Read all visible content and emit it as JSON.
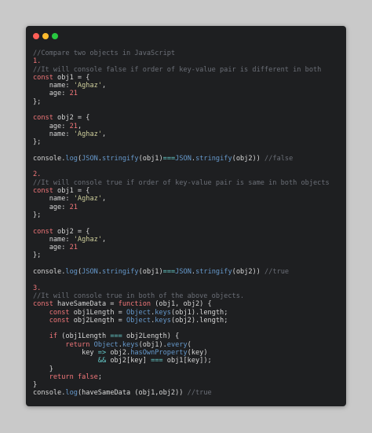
{
  "window": {
    "controls": [
      "close",
      "minimize",
      "zoom"
    ]
  },
  "code_lines": [
    [
      {
        "t": "cm",
        "v": "//Compare two objects in JavaScript"
      }
    ],
    [
      {
        "t": "lbl",
        "v": "1."
      }
    ],
    [
      {
        "t": "cm",
        "v": "//It will console false if order of key-value pair is different in both"
      }
    ],
    [
      {
        "t": "kw",
        "v": "const"
      },
      {
        "t": "var",
        "v": " obj1 = {"
      }
    ],
    [
      {
        "t": "txt",
        "v": "    name: "
      },
      {
        "t": "str",
        "v": "'Aghaz'"
      },
      {
        "t": "txt",
        "v": ","
      }
    ],
    [
      {
        "t": "txt",
        "v": "    age: "
      },
      {
        "t": "num",
        "v": "21"
      }
    ],
    [
      {
        "t": "txt",
        "v": "};"
      }
    ],
    [],
    [
      {
        "t": "kw",
        "v": "const"
      },
      {
        "t": "var",
        "v": " obj2 = {"
      }
    ],
    [
      {
        "t": "txt",
        "v": "    age: "
      },
      {
        "t": "num",
        "v": "21"
      },
      {
        "t": "txt",
        "v": ","
      }
    ],
    [
      {
        "t": "txt",
        "v": "    name: "
      },
      {
        "t": "str",
        "v": "'Aghaz'"
      },
      {
        "t": "txt",
        "v": ","
      }
    ],
    [
      {
        "t": "txt",
        "v": "};"
      }
    ],
    [],
    [
      {
        "t": "txt",
        "v": "console."
      },
      {
        "t": "fn",
        "v": "log"
      },
      {
        "t": "txt",
        "v": "("
      },
      {
        "t": "fn",
        "v": "JSON"
      },
      {
        "t": "txt",
        "v": "."
      },
      {
        "t": "fn",
        "v": "stringify"
      },
      {
        "t": "txt",
        "v": "(obj1)"
      },
      {
        "t": "op",
        "v": "==="
      },
      {
        "t": "fn",
        "v": "JSON"
      },
      {
        "t": "txt",
        "v": "."
      },
      {
        "t": "fn",
        "v": "stringify"
      },
      {
        "t": "txt",
        "v": "(obj2)) "
      },
      {
        "t": "cm",
        "v": "//false"
      }
    ],
    [],
    [
      {
        "t": "lbl",
        "v": "2."
      }
    ],
    [
      {
        "t": "cm",
        "v": "//It will console true if order of key-value pair is same in both objects"
      }
    ],
    [
      {
        "t": "kw",
        "v": "const"
      },
      {
        "t": "var",
        "v": " obj1 = {"
      }
    ],
    [
      {
        "t": "txt",
        "v": "    name: "
      },
      {
        "t": "str",
        "v": "'Aghaz'"
      },
      {
        "t": "txt",
        "v": ","
      }
    ],
    [
      {
        "t": "txt",
        "v": "    age: "
      },
      {
        "t": "num",
        "v": "21"
      }
    ],
    [
      {
        "t": "txt",
        "v": "};"
      }
    ],
    [],
    [
      {
        "t": "kw",
        "v": "const"
      },
      {
        "t": "var",
        "v": " obj2 = {"
      }
    ],
    [
      {
        "t": "txt",
        "v": "    name: "
      },
      {
        "t": "str",
        "v": "'Aghaz'"
      },
      {
        "t": "txt",
        "v": ","
      }
    ],
    [
      {
        "t": "txt",
        "v": "    age: "
      },
      {
        "t": "num",
        "v": "21"
      }
    ],
    [
      {
        "t": "txt",
        "v": "};"
      }
    ],
    [],
    [
      {
        "t": "txt",
        "v": "console."
      },
      {
        "t": "fn",
        "v": "log"
      },
      {
        "t": "txt",
        "v": "("
      },
      {
        "t": "fn",
        "v": "JSON"
      },
      {
        "t": "txt",
        "v": "."
      },
      {
        "t": "fn",
        "v": "stringify"
      },
      {
        "t": "txt",
        "v": "(obj1)"
      },
      {
        "t": "op",
        "v": "==="
      },
      {
        "t": "fn",
        "v": "JSON"
      },
      {
        "t": "txt",
        "v": "."
      },
      {
        "t": "fn",
        "v": "stringify"
      },
      {
        "t": "txt",
        "v": "(obj2)) "
      },
      {
        "t": "cm",
        "v": "//true"
      }
    ],
    [],
    [
      {
        "t": "lbl",
        "v": "3."
      }
    ],
    [
      {
        "t": "cm",
        "v": "//It will console true in both of the above objects."
      }
    ],
    [
      {
        "t": "kw",
        "v": "const"
      },
      {
        "t": "var",
        "v": " haveSameData = "
      },
      {
        "t": "kw",
        "v": "function"
      },
      {
        "t": "txt",
        "v": " (obj1, obj2) {"
      }
    ],
    [
      {
        "t": "txt",
        "v": "    "
      },
      {
        "t": "kw",
        "v": "const"
      },
      {
        "t": "var",
        "v": " obj1Length = "
      },
      {
        "t": "fn",
        "v": "Object"
      },
      {
        "t": "txt",
        "v": "."
      },
      {
        "t": "fn",
        "v": "keys"
      },
      {
        "t": "txt",
        "v": "(obj1).length;"
      }
    ],
    [
      {
        "t": "txt",
        "v": "    "
      },
      {
        "t": "kw",
        "v": "const"
      },
      {
        "t": "var",
        "v": " obj2Length = "
      },
      {
        "t": "fn",
        "v": "Object"
      },
      {
        "t": "txt",
        "v": "."
      },
      {
        "t": "fn",
        "v": "keys"
      },
      {
        "t": "txt",
        "v": "(obj2).length;"
      }
    ],
    [],
    [
      {
        "t": "txt",
        "v": "    "
      },
      {
        "t": "kw",
        "v": "if"
      },
      {
        "t": "txt",
        "v": " (obj1Length "
      },
      {
        "t": "op",
        "v": "==="
      },
      {
        "t": "txt",
        "v": " obj2Length) {"
      }
    ],
    [
      {
        "t": "txt",
        "v": "        "
      },
      {
        "t": "kw",
        "v": "return"
      },
      {
        "t": "txt",
        "v": " "
      },
      {
        "t": "fn",
        "v": "Object"
      },
      {
        "t": "txt",
        "v": "."
      },
      {
        "t": "fn",
        "v": "keys"
      },
      {
        "t": "txt",
        "v": "(obj1)."
      },
      {
        "t": "fn",
        "v": "every"
      },
      {
        "t": "txt",
        "v": "("
      }
    ],
    [
      {
        "t": "txt",
        "v": "            key "
      },
      {
        "t": "op",
        "v": "=>"
      },
      {
        "t": "txt",
        "v": " obj2."
      },
      {
        "t": "fn",
        "v": "hasOwnProperty"
      },
      {
        "t": "txt",
        "v": "(key)"
      }
    ],
    [
      {
        "t": "txt",
        "v": "                "
      },
      {
        "t": "op",
        "v": "&&"
      },
      {
        "t": "txt",
        "v": " obj2[key] "
      },
      {
        "t": "op",
        "v": "==="
      },
      {
        "t": "txt",
        "v": " obj1[key]);"
      }
    ],
    [
      {
        "t": "txt",
        "v": "    }"
      }
    ],
    [
      {
        "t": "txt",
        "v": "    "
      },
      {
        "t": "kw",
        "v": "return"
      },
      {
        "t": "txt",
        "v": " "
      },
      {
        "t": "num",
        "v": "false"
      },
      {
        "t": "txt",
        "v": ";"
      }
    ],
    [
      {
        "t": "txt",
        "v": "}"
      }
    ],
    [
      {
        "t": "txt",
        "v": "console."
      },
      {
        "t": "fn",
        "v": "log"
      },
      {
        "t": "txt",
        "v": "(haveSameData (obj1,obj2)) "
      },
      {
        "t": "cm",
        "v": "//true"
      }
    ]
  ]
}
